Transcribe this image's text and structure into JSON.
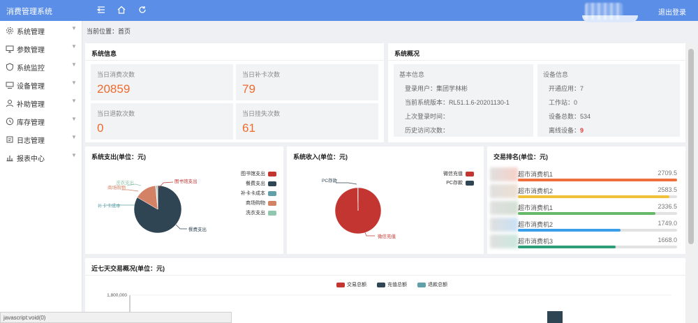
{
  "topbar": {
    "app_title": "消费管理系统",
    "icons": [
      "menu-toggle-icon",
      "home-icon",
      "refresh-icon"
    ],
    "logout_label": "退出登录"
  },
  "sidebar": {
    "items": [
      {
        "label": "系统管理",
        "icon": "gear-icon"
      },
      {
        "label": "参数管理",
        "icon": "monitor-icon"
      },
      {
        "label": "系统监控",
        "icon": "shield-icon"
      },
      {
        "label": "设备管理",
        "icon": "device-icon"
      },
      {
        "label": "补助管理",
        "icon": "user-icon"
      },
      {
        "label": "库存管理",
        "icon": "clock-icon"
      },
      {
        "label": "日志管理",
        "icon": "log-icon"
      },
      {
        "label": "报表中心",
        "icon": "chart-icon"
      }
    ]
  },
  "breadcrumb": "当前位置：首页",
  "system_info": {
    "title": "系统信息",
    "stats": [
      {
        "label": "当日消费次数",
        "value": "20859"
      },
      {
        "label": "当日补卡次数",
        "value": "79"
      },
      {
        "label": "当日退款次数",
        "value": "0"
      },
      {
        "label": "当日挂失次数",
        "value": "61"
      }
    ]
  },
  "overview": {
    "title": "系统概况",
    "basic": {
      "heading": "基本信息",
      "rows": [
        "登录用户：集团学林彬",
        "当前系统版本：RL51.1.6-20201130-1",
        "上次登录时间：",
        "历史访问次数："
      ]
    },
    "device": {
      "heading": "设备信息",
      "rows": [
        "开通应用：7",
        "工作站：0",
        "设备总数：534"
      ],
      "offline_label": "离线设备：",
      "offline_value": "9"
    }
  },
  "expense_chart": {
    "title": "系统支出(单位：元)",
    "legend": [
      "图书馆支出",
      "餐费支出",
      "补卡卡成本",
      "商场购物",
      "洗衣支出"
    ],
    "callouts": [
      "洗衣支出",
      "商场购物",
      "图书馆支出",
      "补卡卡成本",
      "餐费支出"
    ]
  },
  "income_chart": {
    "title": "系统收入(单位：元)",
    "legend": [
      "微信充值",
      "PC存款"
    ],
    "callouts": [
      "PC存款",
      "微信充值"
    ]
  },
  "ranking": {
    "title": "交易排名(单位：元)",
    "rows": [
      {
        "name": "超市消费机1",
        "value": "2709.5",
        "fraction": 1.0
      },
      {
        "name": "超市消费机2",
        "value": "2583.5",
        "fraction": 0.953
      },
      {
        "name": "超市消费机1",
        "value": "2336.5",
        "fraction": 0.862
      },
      {
        "name": "超市消费机2",
        "value": "1749.0",
        "fraction": 0.646
      },
      {
        "name": "超市消费机3",
        "value": "1668.0",
        "fraction": 0.616
      }
    ]
  },
  "weekly": {
    "title": "近七天交易概况(单位：元)",
    "legend": [
      "交易总额",
      "充值总额",
      "退款总额"
    ],
    "ytick": "1,800,000"
  },
  "colors": {
    "accent": "#5b8ee6",
    "stat_value": "#f06a2e",
    "red": "#c23531",
    "navy": "#2f4554",
    "teal": "#61a0a8",
    "orange": "#d48265",
    "green": "#91c7ae",
    "rank_bars": [
      "#ee6e3c",
      "#f2c13a",
      "#68b86a",
      "#3a9ee8",
      "#2f9e78"
    ]
  },
  "status_bar": "javascript:void(0)",
  "chart_data": [
    {
      "type": "pie",
      "title": "系统支出(单位：元)",
      "labels": [
        "餐费支出",
        "商场购物",
        "补卡卡成本",
        "洗衣支出",
        "图书馆支出"
      ],
      "values": [
        83,
        15,
        0.4,
        0.8,
        0.3
      ],
      "colors": [
        "#2f4554",
        "#d48265",
        "#61a0a8",
        "#91c7ae",
        "#c23531"
      ]
    },
    {
      "type": "pie",
      "title": "系统收入(单位：元)",
      "labels": [
        "微信充值",
        "PC存款"
      ],
      "values": [
        99.6,
        0.4
      ],
      "colors": [
        "#c23531",
        "#2f4554"
      ]
    },
    {
      "type": "bar",
      "title": "交易排名(单位：元)",
      "categories": [
        "超市消费机1",
        "超市消费机2",
        "超市消费机1",
        "超市消费机2",
        "超市消费机3"
      ],
      "values": [
        2709.5,
        2583.5,
        2336.5,
        1749.0,
        1668.0
      ]
    }
  ]
}
